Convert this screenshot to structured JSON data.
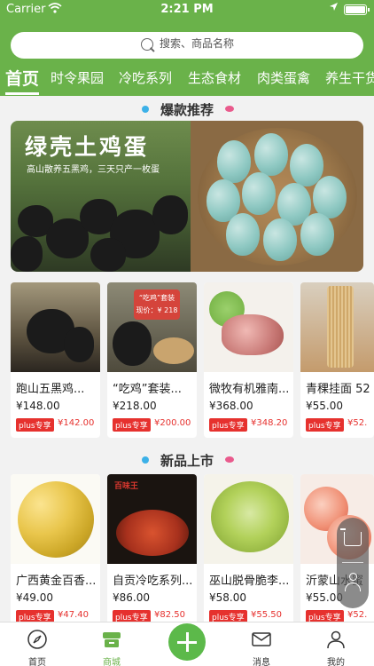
{
  "status_bar": {
    "carrier": "Carrier",
    "time": "2:21 PM"
  },
  "search": {
    "placeholder": "搜索、商品名称"
  },
  "tabs": [
    {
      "label": "首页",
      "active": true
    },
    {
      "label": "时令果园"
    },
    {
      "label": "冷吃系列"
    },
    {
      "label": "生态食材"
    },
    {
      "label": "肉类蛋禽"
    },
    {
      "label": "养生干货"
    }
  ],
  "sections": {
    "hot": {
      "title": "爆款推荐"
    },
    "new": {
      "title": "新品上市"
    }
  },
  "banner": {
    "headline": "绿壳土鸡蛋",
    "subtitle": "高山散养五黑鸡，三天只产一枚蛋"
  },
  "hot_products": [
    {
      "name": "跑山五黑鸡...",
      "price": "¥148.00",
      "tag": "plus专享",
      "plus_price": "¥142.00"
    },
    {
      "name": "“吃鸡”套装...",
      "price": "¥218.00",
      "tag": "plus专享",
      "plus_price": "¥200.00",
      "image_badge": "“吃鸡”套装",
      "image_badge_price": "现价：¥ 218"
    },
    {
      "name": "微牧有机雅南...",
      "price": "¥368.00",
      "tag": "plus专享",
      "plus_price": "¥348.20"
    },
    {
      "name": "青稞挂面 52",
      "price": "¥55.00",
      "tag": "plus专享",
      "plus_price": "¥52."
    }
  ],
  "new_products": [
    {
      "name": "广西黄金百香...",
      "price": "¥49.00",
      "tag": "plus专享",
      "plus_price": "¥47.40"
    },
    {
      "name": "自贡冷吃系列...",
      "price": "¥86.00",
      "tag": "plus专享",
      "plus_price": "¥82.50",
      "image_badge": "百味王"
    },
    {
      "name": "巫山脱骨脆李...",
      "price": "¥58.00",
      "tag": "plus专享",
      "plus_price": "¥55.50"
    },
    {
      "name": "沂蒙山水蜜",
      "price": "¥55.00",
      "tag": "plus专享",
      "plus_price": "¥52."
    }
  ],
  "tabbar": [
    {
      "label": "首页",
      "icon": "compass-icon"
    },
    {
      "label": "商城",
      "icon": "store-icon",
      "active": true
    },
    {
      "label": "",
      "icon": "plus-icon"
    },
    {
      "label": "消息",
      "icon": "mail-icon"
    },
    {
      "label": "我的",
      "icon": "user-icon"
    }
  ],
  "colors": {
    "brand_green": "#6ab24a",
    "price_red": "#e6312e"
  }
}
